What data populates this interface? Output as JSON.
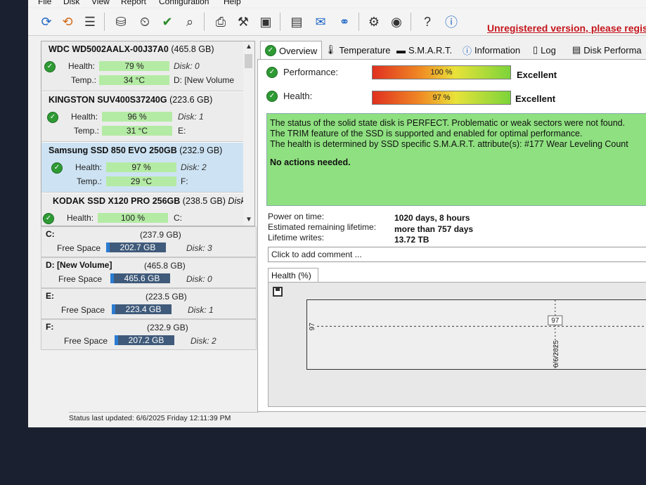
{
  "menu": [
    "File",
    "Disk",
    "View",
    "Report",
    "Configuration",
    "Help"
  ],
  "toolbar": {
    "icons": [
      "refresh-icon",
      "refresh-all-icon",
      "list-icon",
      "disk-icon",
      "disk-clock-icon",
      "disk-check-icon",
      "disk-search-icon",
      "printer-icon",
      "tools-icon",
      "package-icon",
      "notes-icon",
      "mail-icon",
      "network-icon",
      "settings-icon",
      "speaker-icon",
      "help-icon",
      "info-icon"
    ]
  },
  "unregistered": "Unregistered version, please regis",
  "disks": [
    {
      "name": "WDC WD5002AALX-00J37A0",
      "size": "(465.8 GB)",
      "health_label": "Health:",
      "health": "79 %",
      "temp_label": "Temp.:",
      "temp": "34 °C",
      "disk": "Disk: 0",
      "letter": "D: [New Volume"
    },
    {
      "name": "KINGSTON SUV400S37240G",
      "size": "(223.6 GB)",
      "health_label": "Health:",
      "health": "96 %",
      "temp_label": "Temp.:",
      "temp": "31 °C",
      "disk": "Disk: 1",
      "letter": "E:"
    },
    {
      "name": "Samsung SSD 850 EVO 250GB",
      "size": "(232.9 GB)",
      "health_label": "Health:",
      "health": "97 %",
      "temp_label": "Temp.:",
      "temp": "29 °C",
      "disk": "Disk: 2",
      "letter": "F:"
    },
    {
      "name": "KODAK SSD X120 PRO 256GB",
      "size": "(238.5 GB)",
      "disk_inline": "Disk:",
      "health_label": "Health:",
      "health": "100 %",
      "letter": "C:"
    }
  ],
  "volumes": [
    {
      "name": "C:",
      "size": "(237.9 GB)",
      "free_label": "Free Space",
      "free": "202.7 GB",
      "disk": "Disk: 3"
    },
    {
      "name": "D: [New Volume]",
      "size": "(465.8 GB)",
      "free_label": "Free Space",
      "free": "465.6 GB",
      "disk": "Disk: 0"
    },
    {
      "name": "E:",
      "size": "(223.5 GB)",
      "free_label": "Free Space",
      "free": "223.4 GB",
      "disk": "Disk: 1"
    },
    {
      "name": "F:",
      "size": "(232.9 GB)",
      "free_label": "Free Space",
      "free": "207.2 GB",
      "disk": "Disk: 2"
    }
  ],
  "status": "Status last updated: 6/6/2025 Friday 12:11:39 PM",
  "tabs": [
    "Overview",
    "Temperature",
    "S.M.A.R.T.",
    "Information",
    "Log",
    "Disk Performa"
  ],
  "overview": {
    "performance_label": "Performance:",
    "performance_value": "100 %",
    "performance_text": "Excellent",
    "health_label": "Health:",
    "health_value": "97 %",
    "health_text": "Excellent",
    "messages": [
      "The status of the solid state disk is PERFECT. Problematic or weak sectors were not found.",
      "The TRIM feature of the SSD is supported and enabled for optimal performance.",
      "The health is determined by SSD specific S.M.A.R.T. attribute(s):  #177 Wear Leveling Count"
    ],
    "actions": "No actions needed.",
    "power_on_label": "Power on time:",
    "power_on_value": "1020 days, 8 hours",
    "remaining_label": "Estimated remaining lifetime:",
    "remaining_value": "more than 757 days",
    "writes_label": "Lifetime writes:",
    "writes_value": "13.72 TB",
    "comment_placeholder": "Click to add comment ..."
  },
  "chart_data": {
    "type": "line",
    "title": "Health (%)",
    "x": [
      "6/6/2025"
    ],
    "series": [
      {
        "values": [
          97
        ]
      }
    ],
    "y_tick_label": "97",
    "point_label": "97"
  }
}
